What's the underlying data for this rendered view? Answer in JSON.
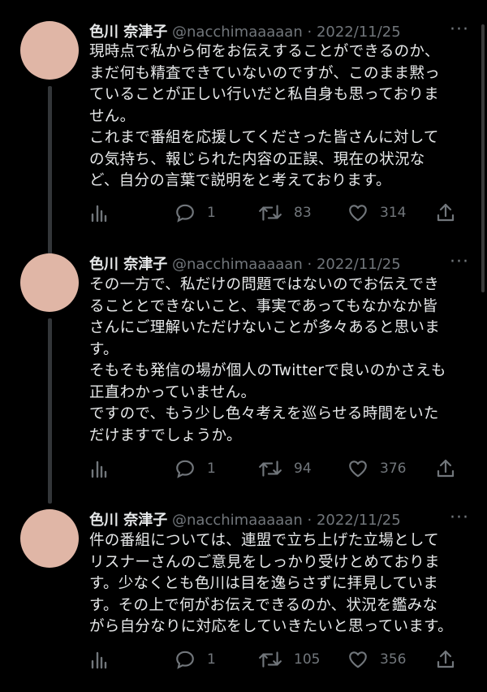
{
  "tweets": [
    {
      "name": "色川 奈津子",
      "handle": "@nacchimaaaaan",
      "sep": "·",
      "date": "2022/11/25",
      "lines": [
        "現時点で私から何をお伝えすることができるのか、",
        "まだ何も精査できていないのですが、このまま黙っ",
        "ていることが正しい行いだと私自身も思っておりま",
        "せん。",
        "これまで番組を応援してくださった皆さんに対して",
        "の気持ち、報じられた内容の正誤、現在の状況な",
        "ど、自分の言葉で説明をと考えております。"
      ],
      "replies": "1",
      "retweets": "83",
      "likes": "314"
    },
    {
      "name": "色川 奈津子",
      "handle": "@nacchimaaaaan",
      "sep": "·",
      "date": "2022/11/25",
      "lines": [
        "その一方で、私だけの問題ではないのでお伝えでき",
        "ることとできないこと、事実であってもなかなか皆",
        "さんにご理解いただけないことが多々あると思いま",
        "す。",
        "そもそも発信の場が個人のTwitterで良いのかさえも",
        "正直わかっていません。",
        "ですので、もう少し色々考えを巡らせる時間をいた",
        "だけますでしょうか。"
      ],
      "replies": "1",
      "retweets": "94",
      "likes": "376"
    },
    {
      "name": "色川 奈津子",
      "handle": "@nacchimaaaaan",
      "sep": "·",
      "date": "2022/11/25",
      "lines": [
        "件の番組については、連盟で立ち上げた立場として",
        "リスナーさんのご意見をしっかり受けとめておりま",
        "す。少なくとも色川は目を逸らさずに拝見していま",
        "す。その上で何がお伝えできるのか、状況を鑑みな",
        "がら自分なりに対応をしていきたいと思っています。"
      ],
      "replies": "1",
      "retweets": "105",
      "likes": "356"
    }
  ],
  "icons": {
    "more": "more-icon",
    "analytics": "analytics-icon",
    "reply": "reply-icon",
    "retweet": "retweet-icon",
    "like": "heart-icon",
    "share": "share-icon"
  },
  "colors": {
    "background": "#000000",
    "text": "#e7e9ea",
    "muted": "#71767b",
    "thread_line": "#333639",
    "avatar": "#e0b6a6"
  }
}
